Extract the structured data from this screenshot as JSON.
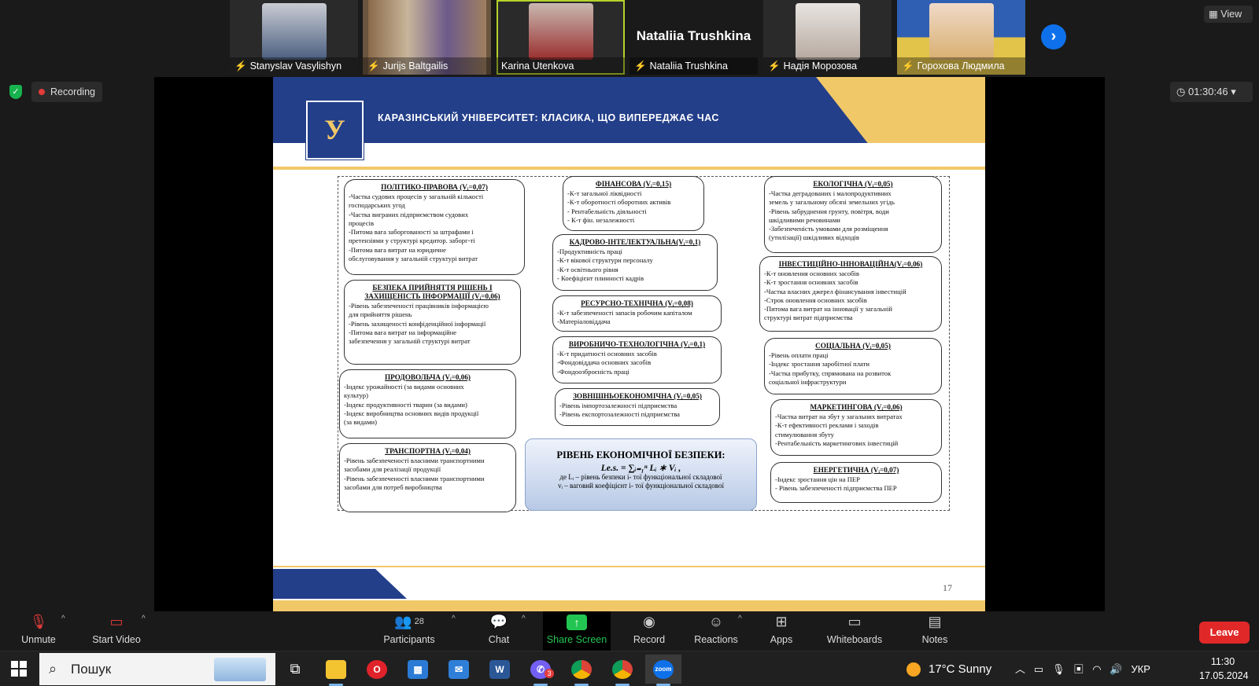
{
  "participants": [
    {
      "name": "Stanyslav Vasylishyn",
      "muted": true,
      "pic_color": "#5b6f8f"
    },
    {
      "name": "Jurijs Baltgailis",
      "muted": true,
      "pic_color": "#8a6a4a"
    },
    {
      "name": "Karina Utenkova",
      "muted": false,
      "pic_color": "#9a2f2f"
    },
    {
      "name": "Nataliia Trushkina",
      "muted": true,
      "display": "Nataliia Trushkina"
    },
    {
      "name": "Надія Морозова",
      "muted": true,
      "pic_color": "#b7a9a0"
    },
    {
      "name": "Горохова Людмила",
      "muted": true,
      "pic_color": "#e2c44a"
    }
  ],
  "gallery_next_icon": "chevron-right-icon",
  "view_label": "View",
  "recording_label": "Recording",
  "timer": "01:30:46",
  "slide": {
    "title": "КАРАЗІНСЬКИЙ УНІВЕРСИТЕТ: КЛАСИКА, ЩО ВИПЕРЕДЖАЄ ЧАС",
    "logo_letter": "У",
    "page_number": "17",
    "boxes": [
      {
        "title": "ПОЛІТИКО-ПРАВОВА (Vᵢ=0,07)",
        "items": [
          "-Частка судових процесів у загальній кількості",
          "господарських угод",
          "-Частка виграних підприємством судових",
          "процесів",
          "-Питома вага заборгованості за штрафами і",
          "претензіями у структурі кредитор. заборг-ті",
          "-Питома вага витрат на юридичне",
          "обслуговування у загальній структурі витрат"
        ]
      },
      {
        "title": "БЕЗПЕКА ПРИЙНЯТТЯ РІШЕНЬ І ЗАХИЩЕНІСТЬ ІНФОРМАЦІЇ (Vᵢ=0,06)",
        "items": [
          "-Рівень забезпеченості працівників інформацією",
          "для прийняття рішень",
          "-Рівень захищеності конфіденційної інформації",
          "-Питома вага витрат на інформаційне",
          "забезпечення у загальній структурі витрат"
        ]
      },
      {
        "title": "ПРОДОВОЛЬЧА (Vᵢ=0,06)",
        "items": [
          "-Індекс урожайності (за видами основних",
          "культур)",
          "-Індекс продуктивності тварин (за видами)",
          "-Індекс виробництва основних видів продукції",
          "(за видами)"
        ]
      },
      {
        "title": "ТРАНСПОРТНА (Vᵢ=0,04)",
        "items": [
          "-Рівень забезпеченості власними транспортними",
          "засобами для реалізації продукції",
          "-Рівень забезпеченості власними транспортними",
          "засобами для потреб виробництва"
        ]
      },
      {
        "title": "ФІНАНСОВА (Vᵢ=0,15)",
        "items": [
          "-К-т загальної ліквідності",
          "-К-т оборотності оборотних активів",
          "- Рентабельність діяльності",
          "- К-т фін. незалежності"
        ]
      },
      {
        "title": "КАДРОВО-ІНТЕЛЕКТУАЛЬНА(Vᵢ=0,1)",
        "items": [
          "-Продуктивність праці",
          "-К-т вікової структури персоналу",
          "-К-т освітнього рівня",
          "- Коефіцієнт плинності кадрів"
        ]
      },
      {
        "title": "РЕСУРСНО-ТЕХНІЧНА (Vᵢ=0,08)",
        "items": [
          "-К-т забезпеченості запасів робочим капіталом",
          "-Матеріаловіддача"
        ]
      },
      {
        "title": "ВИРОБНИЧО-ТЕХНОЛОГІЧНА (Vᵢ=0,1)",
        "items": [
          "-К-т придатності основних засобів",
          "-Фондовіддача основних засобів",
          "-Фондоозброєність праці"
        ]
      },
      {
        "title": "ЗОВНІШНЬОЕКОНОМІЧНА (Vᵢ=0,05)",
        "items": [
          "-Рівень імпортозалежності підприємства",
          "-Рівень експортозалежності підприємства"
        ]
      },
      {
        "title": "ЕКОЛОГІЧНА (Vᵢ=0,05)",
        "items": [
          "-Частка деградованих і малопродуктивних",
          "земель у загальному обсязі земельних угідь",
          "-Рівень забруднення грунту, повітря, води",
          "шкідливими речовинами",
          "-Забезпеченість умовами для розміщення",
          "(утилізації) шкідливих відходів"
        ]
      },
      {
        "title": "ІНВЕСТИЦІЙНО-ІННОВАЦІЙНА(Vᵢ=0,06)",
        "items": [
          "-К-т оновлення основних засобів",
          "-К-т зростання основних засобів",
          "-Частка власних джерел фінансування інвестицій",
          "-Строк оновлення основних засобів",
          "-Питома вага витрат на інновації у загальній",
          "структурі витрат підприємства"
        ]
      },
      {
        "title": "СОЦІАЛЬНА (Vᵢ=0,05)",
        "items": [
          "-Рівень оплати праці",
          "-Індекс зростання заробітної плати",
          "-Частка прибутку, спрямована на розвиток",
          "соціальної інфраструктури"
        ]
      },
      {
        "title": "МАРКЕТИНГОВА (Vᵢ=0,06)",
        "items": [
          "-Частка витрат на збут у загальних витратах",
          "-К-т ефективності реклами і заходів",
          "стимулювання збуту",
          "-Рентабельність маркетингових інвестицій"
        ]
      },
      {
        "title": "ЕНЕРГЕТИЧНА (Vᵢ=0,07)",
        "items": [
          "-Індекс зростання цін на ПЕР",
          "- Рівень забезпеченості підприємства ПЕР"
        ]
      }
    ],
    "center": {
      "title": "РІВЕНЬ ЕКОНОМІЧНОЇ БЕЗПЕКИ:",
      "formula": "Le.s. = ∑ᵢ₌₁ⁿ Lᵢ ∗ Vᵢ ,",
      "line1": "де Lᵢ – рівень безпеки і- тої функціональної складової",
      "line2": "vᵢ – ваговий коефіцієнт і- тої функціональної складової"
    }
  },
  "controls": {
    "unmute": "Unmute",
    "start_video": "Start Video",
    "participants": "Participants",
    "participants_count": "28",
    "chat": "Chat",
    "share_screen": "Share Screen",
    "record": "Record",
    "reactions": "Reactions",
    "apps": "Apps",
    "whiteboards": "Whiteboards",
    "notes": "Notes",
    "leave": "Leave"
  },
  "taskbar": {
    "search_placeholder": "Пошук",
    "weather": "17°C  Sunny",
    "language": "УКР",
    "time": "11:30",
    "date": "17.05.2024",
    "notifications": "2",
    "viber_badge": "3"
  },
  "colors": {
    "accent_green": "#23c552",
    "leave_red": "#e02828",
    "slide_blue": "#233f8a",
    "slide_gold": "#f1c868",
    "zoom_blue": "#0e71eb"
  }
}
